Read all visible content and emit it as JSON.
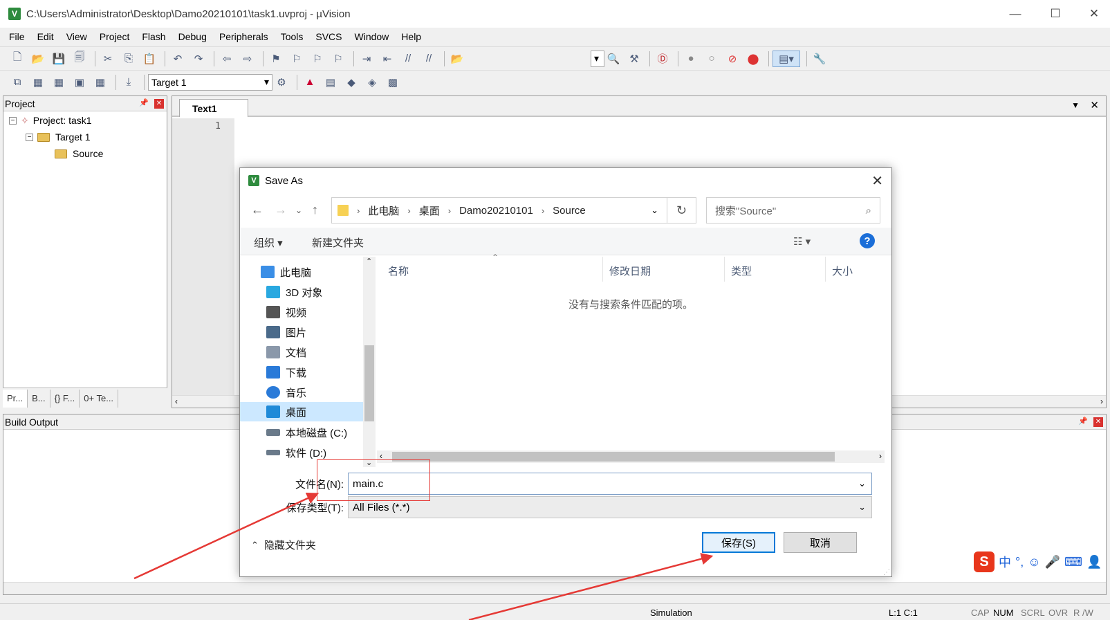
{
  "window": {
    "title": "C:\\Users\\Administrator\\Desktop\\Damo20210101\\task1.uvproj - µVision",
    "app_icon": "V",
    "minimize": "—",
    "maximize": "☐",
    "close": "✕"
  },
  "menu": [
    "File",
    "Edit",
    "View",
    "Project",
    "Flash",
    "Debug",
    "Peripherals",
    "Tools",
    "SVCS",
    "Window",
    "Help"
  ],
  "toolbar2": {
    "target_label": "Target 1"
  },
  "project_panel": {
    "title": "Project",
    "root": "Project: task1",
    "target": "Target 1",
    "group": "Source",
    "tabs": [
      "Pr...",
      "B...",
      "{} F...",
      "0+ Te..."
    ]
  },
  "editor": {
    "tab": "Text1",
    "line_number": "1"
  },
  "build_output": {
    "title": "Build Output"
  },
  "statusbar": {
    "mode": "Simulation",
    "position": "L:1 C:1",
    "indicators": [
      "CAP",
      "NUM",
      "SCRL",
      "OVR",
      "R /W"
    ]
  },
  "dialog": {
    "title": "Save As",
    "breadcrumb": [
      "此电脑",
      "桌面",
      "Damo20210101",
      "Source"
    ],
    "search_placeholder": "搜索\"Source\"",
    "commands": {
      "organize": "组织 ▾",
      "new_folder": "新建文件夹"
    },
    "nav_items": [
      {
        "label": "此电脑",
        "icon": "computer-icon",
        "color": "#3a8ee6"
      },
      {
        "label": "3D 对象",
        "icon": "cube-icon",
        "color": "#29a8e0"
      },
      {
        "label": "视频",
        "icon": "film-icon",
        "color": "#555555"
      },
      {
        "label": "图片",
        "icon": "picture-icon",
        "color": "#4a6a8a"
      },
      {
        "label": "文档",
        "icon": "document-icon",
        "color": "#8a98aa"
      },
      {
        "label": "下载",
        "icon": "download-icon",
        "color": "#2a7ad8"
      },
      {
        "label": "音乐",
        "icon": "music-icon",
        "color": "#2a7ad8"
      },
      {
        "label": "桌面",
        "icon": "desktop-icon",
        "color": "#1f8ad8"
      },
      {
        "label": "本地磁盘 (C:)",
        "icon": "drive-icon",
        "color": "#6a7a8a"
      },
      {
        "label": "软件 (D:)",
        "icon": "drive-icon",
        "color": "#6a7a8a"
      }
    ],
    "selected_nav": "桌面",
    "columns": [
      "名称",
      "修改日期",
      "类型",
      "大小"
    ],
    "empty_text": "没有与搜索条件匹配的项。",
    "filename_label": "文件名(N):",
    "filename_value": "main.c",
    "filetype_label": "保存类型(T):",
    "filetype_value": "All Files (*.*)",
    "hide_folders": "隐藏文件夹",
    "save_button": "保存(S)",
    "cancel_button": "取消"
  },
  "ime": {
    "logo": "S",
    "mode": "中"
  },
  "colors": {
    "annotation": "#e53935",
    "accent": "#0078d7"
  }
}
